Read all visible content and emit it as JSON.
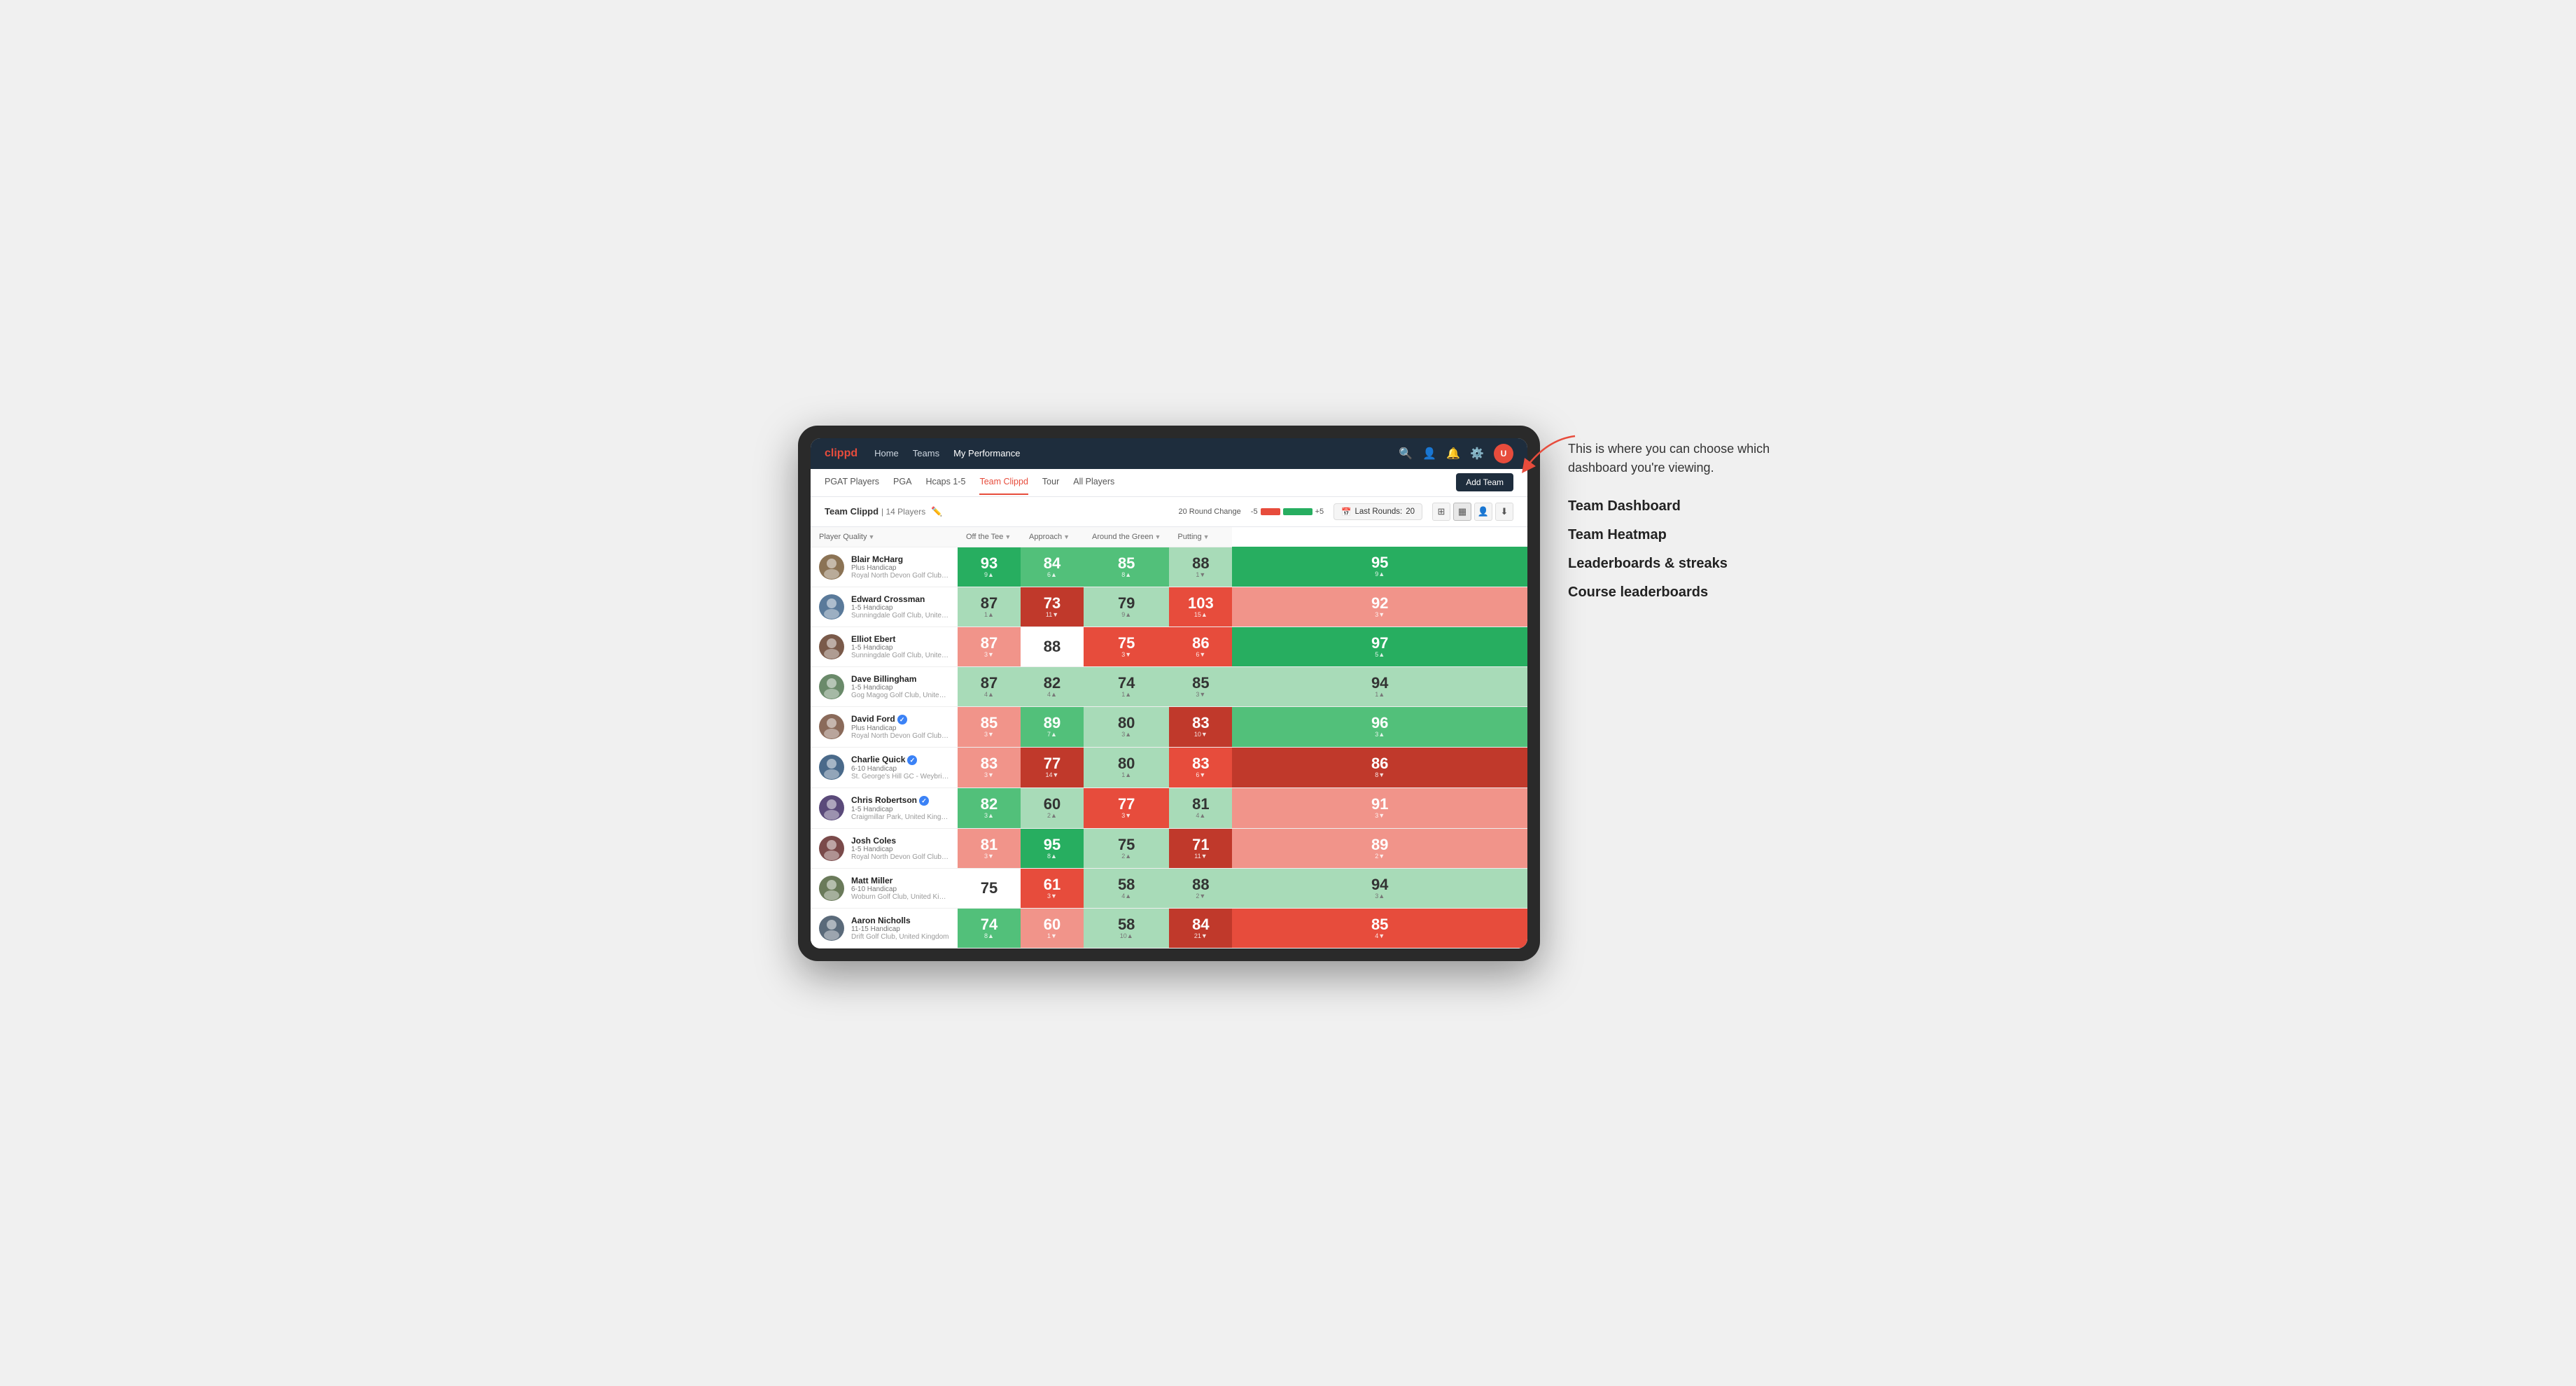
{
  "annotation": {
    "intro_text": "This is where you can choose which dashboard you're viewing.",
    "items": [
      "Team Dashboard",
      "Team Heatmap",
      "Leaderboards & streaks",
      "Course leaderboards"
    ]
  },
  "nav": {
    "logo": "clippd",
    "links": [
      "Home",
      "Teams",
      "My Performance"
    ],
    "active_link": "My Performance"
  },
  "sub_nav": {
    "links": [
      "PGAT Players",
      "PGA",
      "Hcaps 1-5",
      "Team Clippd",
      "Tour",
      "All Players"
    ],
    "active_link": "Team Clippd",
    "add_team_label": "Add Team"
  },
  "team_header": {
    "title": "Team Clippd",
    "separator": "|",
    "count": "14 Players",
    "round_change_label": "20 Round Change",
    "change_minus": "-5",
    "change_plus": "+5",
    "last_rounds_label": "Last Rounds:",
    "last_rounds_value": "20"
  },
  "table": {
    "columns": [
      {
        "label": "Player Quality",
        "sort": true
      },
      {
        "label": "Off the Tee",
        "sort": true
      },
      {
        "label": "Approach",
        "sort": true
      },
      {
        "label": "Around the Green",
        "sort": true
      },
      {
        "label": "Putting",
        "sort": true
      }
    ],
    "rows": [
      {
        "name": "Blair McHarg",
        "handicap": "Plus Handicap",
        "club": "Royal North Devon Golf Club, United Kingdom",
        "avatar_color": "#8B7355",
        "scores": [
          {
            "value": "93",
            "change": "9",
            "dir": "up",
            "color": "green-strong"
          },
          {
            "value": "84",
            "change": "6",
            "dir": "up",
            "color": "green-mid"
          },
          {
            "value": "85",
            "change": "8",
            "dir": "up",
            "color": "green-mid"
          },
          {
            "value": "88",
            "change": "1",
            "dir": "down",
            "color": "green-light"
          },
          {
            "value": "95",
            "change": "9",
            "dir": "up",
            "color": "green-strong"
          }
        ]
      },
      {
        "name": "Edward Crossman",
        "handicap": "1-5 Handicap",
        "club": "Sunningdale Golf Club, United Kingdom",
        "avatar_color": "#5a7a9a",
        "scores": [
          {
            "value": "87",
            "change": "1",
            "dir": "up",
            "color": "green-light"
          },
          {
            "value": "73",
            "change": "11",
            "dir": "down",
            "color": "red-strong"
          },
          {
            "value": "79",
            "change": "9",
            "dir": "up",
            "color": "green-light"
          },
          {
            "value": "103",
            "change": "15",
            "dir": "up",
            "color": "red-mid"
          },
          {
            "value": "92",
            "change": "3",
            "dir": "down",
            "color": "red-light"
          }
        ]
      },
      {
        "name": "Elliot Ebert",
        "handicap": "1-5 Handicap",
        "club": "Sunningdale Golf Club, United Kingdom",
        "avatar_color": "#7a5a4a",
        "scores": [
          {
            "value": "87",
            "change": "3",
            "dir": "down",
            "color": "red-light"
          },
          {
            "value": "88",
            "change": "",
            "dir": "",
            "color": "white"
          },
          {
            "value": "75",
            "change": "3",
            "dir": "down",
            "color": "red-mid"
          },
          {
            "value": "86",
            "change": "6",
            "dir": "down",
            "color": "red-mid"
          },
          {
            "value": "97",
            "change": "5",
            "dir": "up",
            "color": "green-strong"
          }
        ]
      },
      {
        "name": "Dave Billingham",
        "handicap": "1-5 Handicap",
        "club": "Gog Magog Golf Club, United Kingdom",
        "avatar_color": "#6a8a6a",
        "scores": [
          {
            "value": "87",
            "change": "4",
            "dir": "up",
            "color": "green-light"
          },
          {
            "value": "82",
            "change": "4",
            "dir": "up",
            "color": "green-light"
          },
          {
            "value": "74",
            "change": "1",
            "dir": "up",
            "color": "green-light"
          },
          {
            "value": "85",
            "change": "3",
            "dir": "down",
            "color": "green-light"
          },
          {
            "value": "94",
            "change": "1",
            "dir": "up",
            "color": "green-light"
          }
        ]
      },
      {
        "name": "David Ford",
        "verified": true,
        "handicap": "Plus Handicap",
        "club": "Royal North Devon Golf Club, United Kingdom",
        "avatar_color": "#8a6a5a",
        "scores": [
          {
            "value": "85",
            "change": "3",
            "dir": "down",
            "color": "red-light"
          },
          {
            "value": "89",
            "change": "7",
            "dir": "up",
            "color": "green-mid"
          },
          {
            "value": "80",
            "change": "3",
            "dir": "up",
            "color": "green-light"
          },
          {
            "value": "83",
            "change": "10",
            "dir": "down",
            "color": "red-strong"
          },
          {
            "value": "96",
            "change": "3",
            "dir": "up",
            "color": "green-mid"
          }
        ]
      },
      {
        "name": "Charlie Quick",
        "verified": true,
        "handicap": "6-10 Handicap",
        "club": "St. George's Hill GC - Weybridge - Surrey, Uni...",
        "avatar_color": "#4a6a8a",
        "scores": [
          {
            "value": "83",
            "change": "3",
            "dir": "down",
            "color": "red-light"
          },
          {
            "value": "77",
            "change": "14",
            "dir": "down",
            "color": "red-strong"
          },
          {
            "value": "80",
            "change": "1",
            "dir": "up",
            "color": "green-light"
          },
          {
            "value": "83",
            "change": "6",
            "dir": "down",
            "color": "red-mid"
          },
          {
            "value": "86",
            "change": "8",
            "dir": "down",
            "color": "red-strong"
          }
        ]
      },
      {
        "name": "Chris Robertson",
        "verified": true,
        "handicap": "1-5 Handicap",
        "club": "Craigmillar Park, United Kingdom",
        "avatar_color": "#5a4a7a",
        "scores": [
          {
            "value": "82",
            "change": "3",
            "dir": "up",
            "color": "green-mid"
          },
          {
            "value": "60",
            "change": "2",
            "dir": "up",
            "color": "green-light"
          },
          {
            "value": "77",
            "change": "3",
            "dir": "down",
            "color": "red-mid"
          },
          {
            "value": "81",
            "change": "4",
            "dir": "up",
            "color": "green-light"
          },
          {
            "value": "91",
            "change": "3",
            "dir": "down",
            "color": "red-light"
          }
        ]
      },
      {
        "name": "Josh Coles",
        "handicap": "1-5 Handicap",
        "club": "Royal North Devon Golf Club, United Kingdom",
        "avatar_color": "#7a4a4a",
        "scores": [
          {
            "value": "81",
            "change": "3",
            "dir": "down",
            "color": "red-light"
          },
          {
            "value": "95",
            "change": "8",
            "dir": "up",
            "color": "green-strong"
          },
          {
            "value": "75",
            "change": "2",
            "dir": "up",
            "color": "green-light"
          },
          {
            "value": "71",
            "change": "11",
            "dir": "down",
            "color": "red-strong"
          },
          {
            "value": "89",
            "change": "2",
            "dir": "down",
            "color": "red-light"
          }
        ]
      },
      {
        "name": "Matt Miller",
        "handicap": "6-10 Handicap",
        "club": "Woburn Golf Club, United Kingdom",
        "avatar_color": "#6a7a5a",
        "scores": [
          {
            "value": "75",
            "change": "",
            "dir": "",
            "color": "white"
          },
          {
            "value": "61",
            "change": "3",
            "dir": "down",
            "color": "red-mid"
          },
          {
            "value": "58",
            "change": "4",
            "dir": "up",
            "color": "green-light"
          },
          {
            "value": "88",
            "change": "2",
            "dir": "down",
            "color": "green-light"
          },
          {
            "value": "94",
            "change": "3",
            "dir": "up",
            "color": "green-light"
          }
        ]
      },
      {
        "name": "Aaron Nicholls",
        "handicap": "11-15 Handicap",
        "club": "Drift Golf Club, United Kingdom",
        "avatar_color": "#5a6a7a",
        "scores": [
          {
            "value": "74",
            "change": "8",
            "dir": "up",
            "color": "green-mid"
          },
          {
            "value": "60",
            "change": "1",
            "dir": "down",
            "color": "red-light"
          },
          {
            "value": "58",
            "change": "10",
            "dir": "up",
            "color": "green-light"
          },
          {
            "value": "84",
            "change": "21",
            "dir": "down",
            "color": "red-strong"
          },
          {
            "value": "85",
            "change": "4",
            "dir": "down",
            "color": "red-mid"
          }
        ]
      }
    ]
  }
}
